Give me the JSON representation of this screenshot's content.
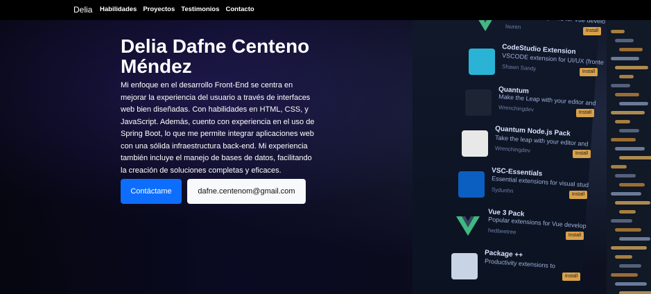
{
  "nav": {
    "brand": "Delia",
    "links": [
      "Habilidades",
      "Proyectos",
      "Testimonios",
      "Contacto"
    ]
  },
  "hero": {
    "title": "Delia Dafne Centeno Méndez",
    "description": "Mi enfoque en el desarrollo Front-End se centra en mejorar la experiencia del usuario a través de interfaces web bien diseñadas. Con habilidades en HTML, CSS, y JavaScript. Además, cuento con experiencia en el uso de Spring Boot, lo que me permite integrar aplicaciones web con una sólida infraestructura back-end. Mi experiencia también incluye el manejo de bases de datos, facilitando la creación de soluciones completas y eficaces.",
    "contact_button": "Contáctame",
    "email_button": "dafne.centenom@gmail.com"
  },
  "extensions": [
    {
      "name": "",
      "line1": "best extension packs for Vue develo",
      "author": "lauren",
      "icon": "vue-icon"
    },
    {
      "name": "CodeStudio Extension",
      "line1": "VSCODE extension for UI/UX (fronte",
      "author": "Shawn Sandy",
      "icon": "codestudio-icon"
    },
    {
      "name": "Quantum",
      "line1": "Make the Leap with your editor and",
      "author": "Wrenchingdev",
      "icon": "quantum-icon"
    },
    {
      "name": "Quantum Node.js Pack",
      "line1": "Take the leap with your editor and",
      "author": "Wrenchingdev",
      "icon": "node-icon"
    },
    {
      "name": "VSC-Essentials",
      "line1": "Essential extensions for visual stud",
      "author": "Sydunhn",
      "icon": "vscode-icon"
    },
    {
      "name": "Vue 3 Pack",
      "line1": "Popular extensions for Vue develop",
      "author": "hedbeetree",
      "icon": "vue-icon"
    },
    {
      "name": "Package ++",
      "line1": "Productivity extensions to",
      "author": "",
      "icon": "package-icon"
    }
  ],
  "install_label": "Install",
  "colors": {
    "primary": "#0d6efd",
    "navbar": "#000000",
    "light": "#f8f9fa"
  }
}
